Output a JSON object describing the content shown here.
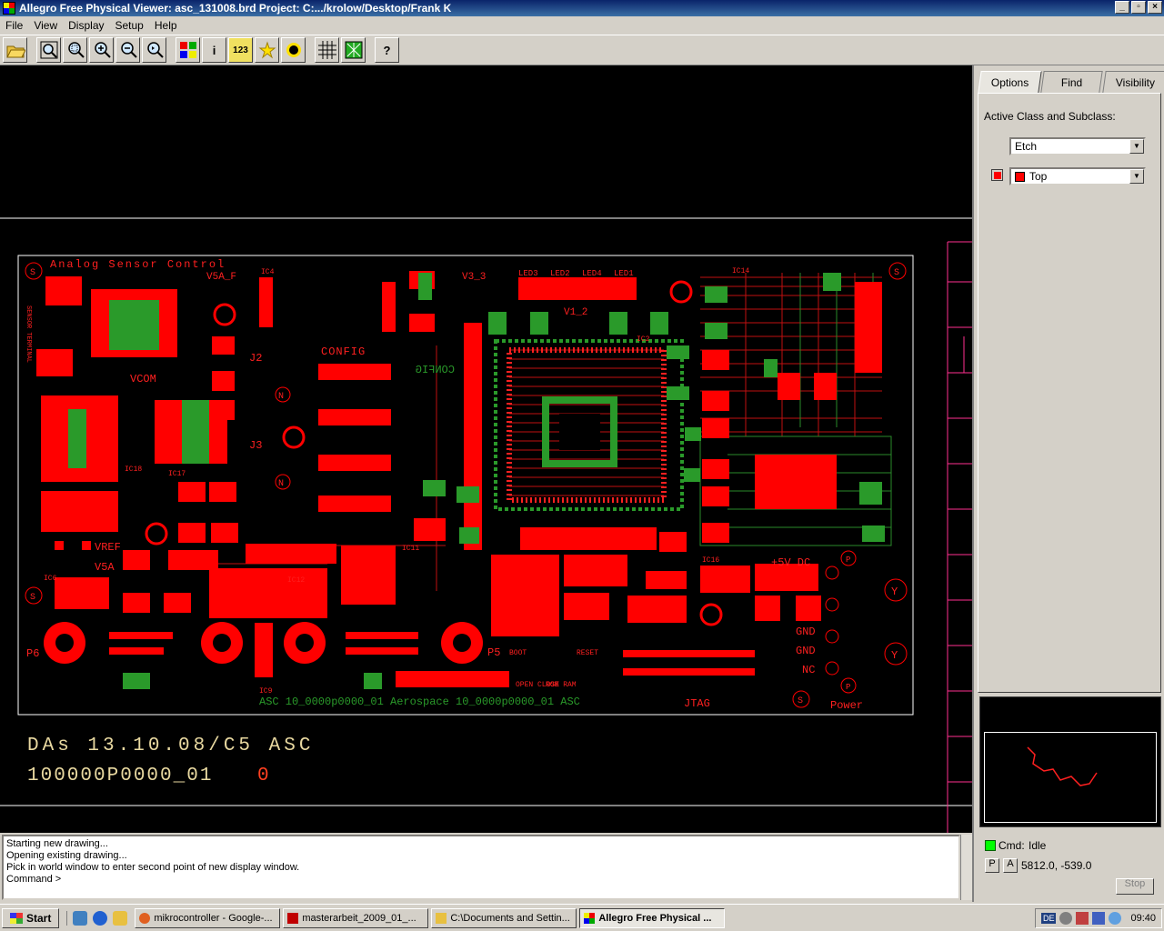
{
  "window": {
    "title": "Allegro Free Physical Viewer: asc_131008.brd  Project: C:.../krolow/Desktop/Frank K",
    "btn_min": "_",
    "btn_max": "▫",
    "btn_close": "×"
  },
  "menu": [
    "File",
    "View",
    "Display",
    "Setup",
    "Help"
  ],
  "toolbar": {
    "icons": [
      "open-icon",
      "zoom-fit-icon",
      "zoom-window-icon",
      "zoom-in-icon",
      "zoom-out-icon",
      "zoom-previous-icon",
      "color-icon",
      "info-icon",
      "measure-icon",
      "highlight-icon",
      "dehighlight-icon",
      "grid-icon",
      "ratsnest-icon",
      "help-icon"
    ],
    "labels": {
      "info": "i",
      "measure": "123",
      "help": "?"
    }
  },
  "board": {
    "title_silk": "Analog Sensor Control",
    "labels": {
      "v5af": "V5A_F",
      "ic4": "IC4",
      "v33": "V3_3",
      "led3": "LED3",
      "led2": "LED2",
      "led4": "LED4",
      "led1": "LED1",
      "ic14": "IC14",
      "v12": "V1_2",
      "ic2": "IC2",
      "config": "CONFIG",
      "config_mirror": "CONFIG",
      "j2": "J2",
      "j3": "J3",
      "vcom": "VCOM",
      "vref": "VREF",
      "v5a": "V5A",
      "ic18": "IC18",
      "ic17": "IC17",
      "ic6": "IC6",
      "ic12": "IC12",
      "ic11": "IC11",
      "ic9": "IC9",
      "ic16": "IC16",
      "p5vdc": "+5V DC",
      "gnd1": "GND",
      "gnd2": "GND",
      "nc": "NC",
      "power": "Power",
      "p6": "P6",
      "p5": "P5",
      "boot": "BOOT",
      "reset": "RESET",
      "open_close": "OPEN CLOSE",
      "rom_ram": "ROM RAM",
      "jtag": "JTAG",
      "sensor_terminal": "SENSOR TERMINAL",
      "bottom_silk": "ASC  10_0000p0000_01  Aerospace  10_0000p0000_01  ASC",
      "n": "N",
      "s": "S",
      "y": "Y",
      "p": "P"
    },
    "info_line1": "DAs 13.10.08/C5 ASC",
    "info_line2": "100000P0000_01",
    "info_rev": "0"
  },
  "panel": {
    "tabs": [
      "Options",
      "Find",
      "Visibility"
    ],
    "active_class_label": "Active Class and Subclass:",
    "class_value": "Etch",
    "subclass_value": "Top",
    "subclass_color": "#ff0000"
  },
  "console": {
    "lines": [
      "Starting new drawing...",
      "Opening existing drawing...",
      "Pick in world window to enter second point of new display window.",
      "Command >"
    ]
  },
  "status": {
    "cmd_label": "Cmd:",
    "cmd_state": "Idle",
    "p_btn": "P",
    "a_btn": "A",
    "coords": "5812.0, -539.0",
    "stop": "Stop"
  },
  "taskbar": {
    "start": "Start",
    "tasks": [
      "mikrocontroller - Google-...",
      "masterarbeit_2009_01_...",
      "C:\\Documents and Settin...",
      "Allegro Free Physical ..."
    ],
    "lang": "DE",
    "time": "09:40"
  }
}
